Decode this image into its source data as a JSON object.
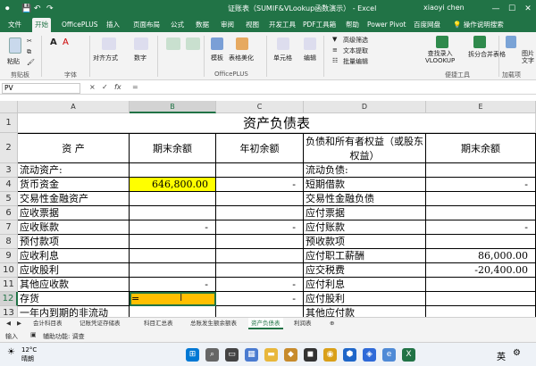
{
  "window": {
    "title": "证账表（SUMIF&VLookup函数演示） - Excel",
    "user": "xiaoyi chen"
  },
  "titlebar_icons": {
    "save": "💾",
    "undo": "↶",
    "redo": "↷"
  },
  "tabs": [
    "文件",
    "开始",
    "OfficePLUS",
    "插入",
    "页面布局",
    "公式",
    "数据",
    "审阅",
    "视图",
    "开发工具",
    "PDF工具箱",
    "帮助",
    "Power Pivot",
    "百度网盘"
  ],
  "search_placeholder": "操作说明搜索",
  "ribbon": {
    "paste": "粘贴",
    "clipboard": "剪贴板",
    "font": "字体",
    "align": "对齐方式",
    "number": "数字",
    "template": "模板",
    "table_beautify": "表格美化",
    "officeplus": "OfficePLUS",
    "cells": "单元格",
    "edit": "编辑",
    "filter_tool": "高级筛选",
    "text_extract": "文本提取",
    "batch_edit": "批量编辑",
    "vlookup": "查找录入\nVLOOKUP",
    "merge_split": "拆分合并表格",
    "convenient": "便捷工具",
    "load": "加载项",
    "image_to": "图片\n文字"
  },
  "formula_bar": {
    "name_box": "PV",
    "x": "×",
    "check": "✓",
    "fx": "fx",
    "content": "="
  },
  "columns": [
    "A",
    "B",
    "C",
    "D",
    "E"
  ],
  "rows": [
    {
      "num": "1",
      "cells": [
        "",
        "",
        "资产负债表",
        "",
        ""
      ]
    },
    {
      "num": "2",
      "cells": [
        "资  产",
        "期末余额",
        "年初余额",
        "负债和所有者权益（或股东权益）",
        "期末余额"
      ]
    },
    {
      "num": "3",
      "cells": [
        "流动资产:",
        "",
        "",
        "流动负债:",
        ""
      ]
    },
    {
      "num": "4",
      "cells": [
        "货币资金",
        "646,800.00",
        "-",
        "短期借款",
        "-"
      ]
    },
    {
      "num": "5",
      "cells": [
        "交易性金融资产",
        "",
        "",
        "交易性金融负债",
        ""
      ]
    },
    {
      "num": "6",
      "cells": [
        "应收票据",
        "",
        "",
        "应付票据",
        ""
      ]
    },
    {
      "num": "7",
      "cells": [
        "应收账款",
        "-",
        "-",
        "应付账款",
        "-"
      ]
    },
    {
      "num": "8",
      "cells": [
        "预付款项",
        "",
        "",
        "预收款项",
        ""
      ]
    },
    {
      "num": "9",
      "cells": [
        "应收利息",
        "",
        "",
        "应付职工薪酬",
        "86,000.00"
      ]
    },
    {
      "num": "10",
      "cells": [
        "应收股利",
        "",
        "",
        "应交税费",
        "-20,400.00"
      ]
    },
    {
      "num": "11",
      "cells": [
        "其他应收款",
        "-",
        "-",
        "应付利息",
        ""
      ]
    },
    {
      "num": "12",
      "cells": [
        "存货",
        "=",
        "-",
        "应付股利",
        ""
      ]
    },
    {
      "num": "13",
      "cells": [
        "一年内到期的非流动",
        "",
        "",
        "其他应付款",
        ""
      ]
    }
  ],
  "row12_cursor": "I",
  "sheet_tabs": [
    "会计科目表",
    "记账凭证存储表",
    "科目汇总表",
    "总账发生额余额表",
    "资产负债表",
    "利润表"
  ],
  "active_sheet": "资产负债表",
  "status": {
    "mode": "输入",
    "accessibility": "辅助功能: 调查"
  },
  "taskbar": {
    "weather_temp": "12°C",
    "weather_desc": "晴朗"
  },
  "colors": {
    "excel_green": "#217346",
    "cell_yellow": "#ffff00",
    "cell_orange": "#ffc000"
  }
}
